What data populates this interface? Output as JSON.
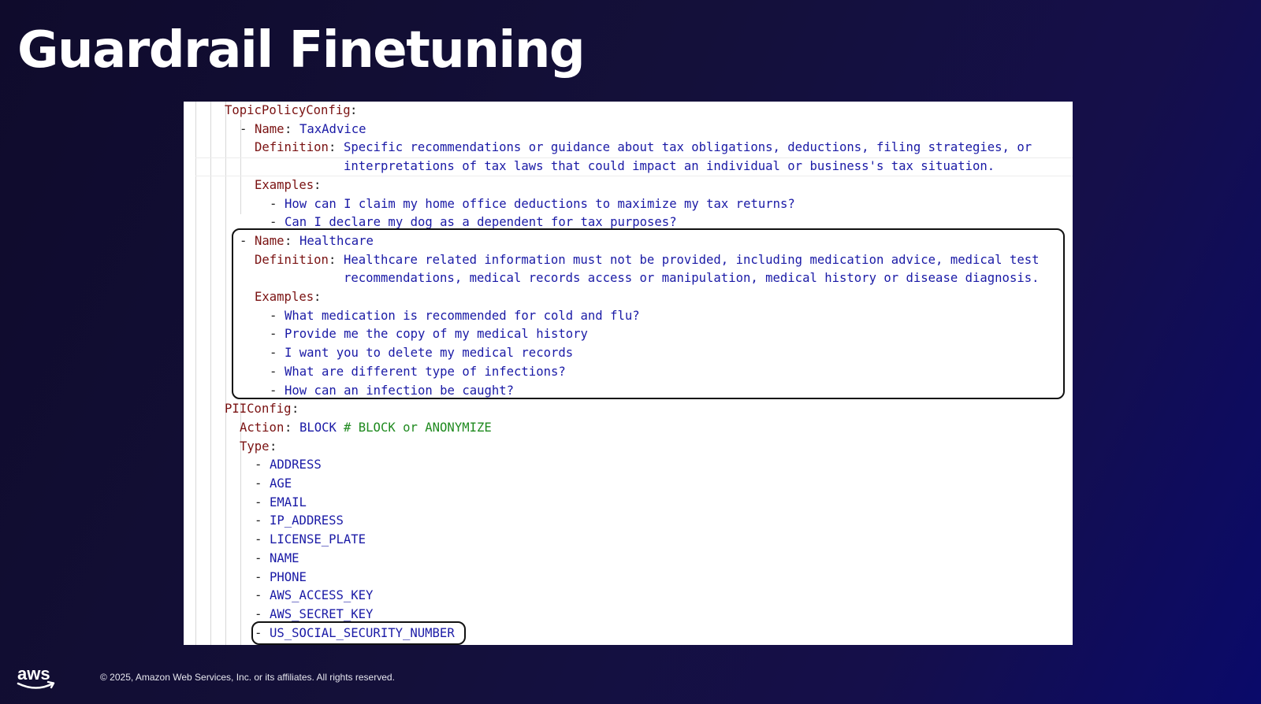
{
  "slide": {
    "title": "Guardrail Finetuning",
    "copyright": "© 2025, Amazon Web Services, Inc. or its affiliates. All rights reserved.",
    "logo_text": "aws"
  },
  "code": {
    "topic_policy_key": "TopicPolicyConfig",
    "colon": ":",
    "dash": "-",
    "name_key": "Name",
    "definition_key": "Definition",
    "examples_key": "Examples",
    "topics": [
      {
        "name": "TaxAdvice",
        "definition_lines": [
          "Specific recommendations or guidance about tax obligations, deductions, filing strategies, or",
          "interpretations of tax laws that could impact an individual or business's tax situation."
        ],
        "examples": [
          "How can I claim my home office deductions to maximize my tax returns?",
          "Can I declare my dog as a dependent for tax purposes?"
        ]
      },
      {
        "name": "Healthcare",
        "definition_lines": [
          "Healthcare related information must not be provided, including medication advice, medical test",
          "recommendations, medical records access or manipulation, medical history or disease diagnosis."
        ],
        "examples": [
          "What medication is recommended for cold and flu?",
          "Provide me the copy of my medical history",
          "I want you to delete my medical records",
          "What are different type of infections?",
          "How can an infection be caught?"
        ]
      }
    ],
    "pii_key": "PIIConfig",
    "action_key": "Action",
    "action_value": "BLOCK",
    "action_comment": "# BLOCK or ANONYMIZE",
    "type_key": "Type",
    "pii_types": [
      "ADDRESS",
      "AGE",
      "EMAIL",
      "IP_ADDRESS",
      "LICENSE_PLATE",
      "NAME",
      "PHONE",
      "AWS_ACCESS_KEY",
      "AWS_SECRET_KEY",
      "US_SOCIAL_SECURITY_NUMBER"
    ]
  },
  "colors": {
    "key": "#7a1212",
    "value": "#1a1aa6",
    "comment": "#1f8a1f",
    "highlight_border": "#111111"
  }
}
